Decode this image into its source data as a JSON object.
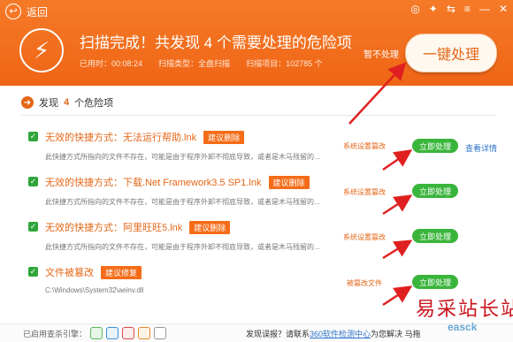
{
  "header": {
    "back_label": "返回",
    "title": "扫描完成！共发现 4 个需要处理的危险项",
    "meta": {
      "time_used": "已用时：00:08:24",
      "scan_type": "扫描类型：全盘扫描",
      "items_scanned": "扫描项目：102785 个"
    },
    "skip_label": "暂不处理",
    "fix_all_label": "一键处理",
    "top_icons": [
      "◎",
      "✦",
      "⇆",
      "≡",
      "—",
      "✕"
    ]
  },
  "list": {
    "header_prefix": "发现",
    "header_count": "4",
    "header_suffix": "个危险项",
    "items": [
      {
        "title": "无效的快捷方式：无法运行帮助.lnk",
        "tag": "建议删除",
        "desc": "此快捷方式所指向的文件不存在，可能是由于程序外卸不彻底导致，或者是木马残留的...",
        "category": "系统设置篡改",
        "button": "立即处理",
        "detail": "查看详情"
      },
      {
        "title": "无效的快捷方式：下载.Net Framework3.5 SP1.lnk",
        "tag": "建议删除",
        "desc": "此快捷方式所指向的文件不存在，可能是由于程序外卸不彻底导致，或者是木马残留的...",
        "category": "系统设置篡改",
        "button": "立即处理"
      },
      {
        "title": "无效的快捷方式：阿里旺旺5.lnk",
        "tag": "建议删除",
        "desc": "此快捷方式所指向的文件不存在，可能是由于程序外卸不彻底导致，或者是木马残留的...",
        "category": "系统设置篡改",
        "button": "立即处理"
      },
      {
        "title": "文件被篡改",
        "tag": "建议修复",
        "desc": "C:\\Windows\\System32\\aeinv.dll",
        "category": "被篡改文件",
        "button": "立即处理"
      }
    ]
  },
  "footer": {
    "engines_label": "已启用查杀引擎：",
    "report_prefix": "发现误报？请联系",
    "report_link": "360软件检测中心",
    "report_suffix": "为您解决",
    "report_tail": "马拖"
  },
  "watermark": {
    "text": "易采站长站",
    "sub": "easck"
  },
  "colors": {
    "accent": "#f36b1c",
    "green": "#3ab53b",
    "link": "#2f74c9",
    "arrow": "#e02020"
  }
}
